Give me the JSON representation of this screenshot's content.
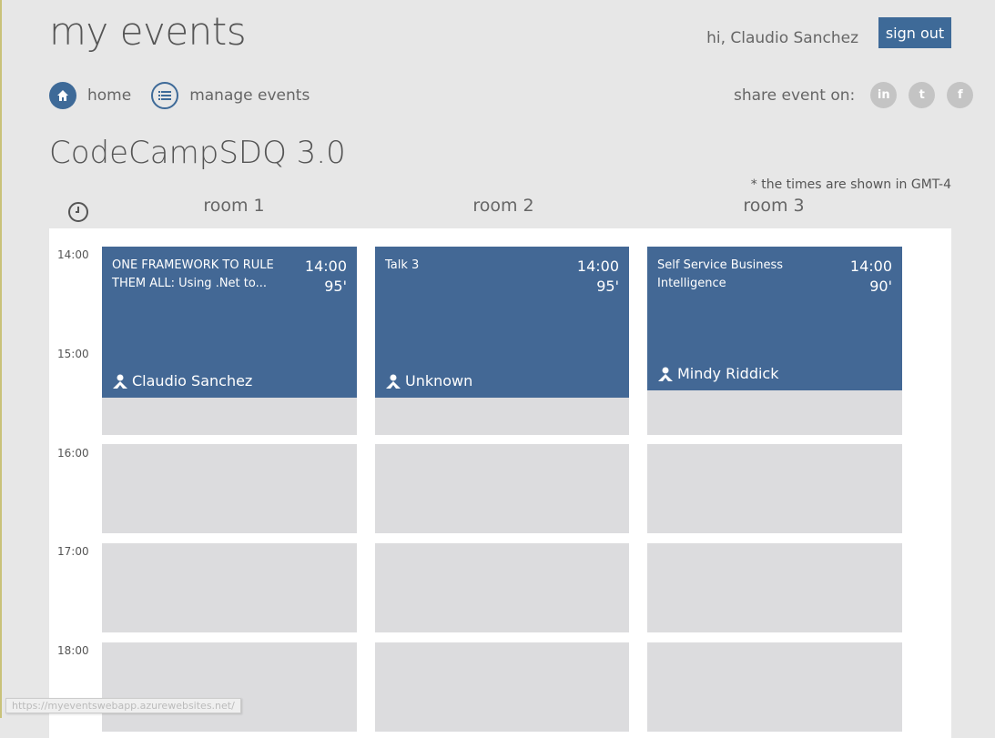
{
  "app": {
    "title": "my events"
  },
  "user": {
    "greeting": "hi, Claudio Sanchez",
    "signout_label": "sign out"
  },
  "nav": {
    "items": [
      {
        "label": "home",
        "icon": "home-icon"
      },
      {
        "label": "manage events",
        "icon": "list-icon"
      }
    ]
  },
  "share": {
    "label": "share event on:",
    "buttons": [
      {
        "glyph": "in",
        "icon": "linkedin-icon"
      },
      {
        "glyph": "t",
        "icon": "twitter-icon"
      },
      {
        "glyph": "f",
        "icon": "facebook-icon"
      }
    ]
  },
  "event": {
    "title": "CodeCampSDQ 3.0",
    "timezone_note": "* the times are shown in GMT-4"
  },
  "rooms": [
    "room 1",
    "room 2",
    "room 3"
  ],
  "times": [
    "14:00",
    "15:00",
    "16:00",
    "17:00",
    "18:00"
  ],
  "sessions": [
    {
      "room": 1,
      "title": "ONE FRAMEWORK TO RULE THEM ALL: Using .Net to...",
      "start": "14:00",
      "duration": "95'",
      "speaker": "Claudio Sanchez"
    },
    {
      "room": 2,
      "title": "Talk 3",
      "start": "14:00",
      "duration": "95'",
      "speaker": "Unknown"
    },
    {
      "room": 3,
      "title": "Self Service Business Intelligence",
      "start": "14:00",
      "duration": "90'",
      "speaker": "Mindy Riddick"
    }
  ],
  "status_bar": {
    "url": "https://myeventswebapp.azurewebsites.net/"
  },
  "colors": {
    "accent": "#3e6a98",
    "event_card": "#436895",
    "slot": "#dcdcde",
    "background": "#e7e7e7"
  }
}
